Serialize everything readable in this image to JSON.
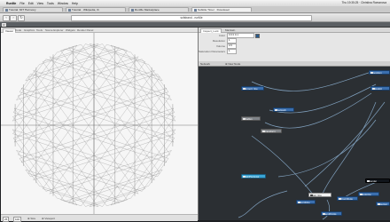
{
  "menubar": {
    "apple": "",
    "app_name": "RunMe",
    "items": [
      "File",
      "Edit",
      "View",
      "Tools",
      "Window",
      "Help"
    ],
    "status": "Thu 19:35:25 · Christina Romanova"
  },
  "browser": {
    "tabs": [
      {
        "label": "Tutorial: MIT Harmony"
      },
      {
        "label": "Tutorial · Wikipedia, th"
      },
      {
        "label": "RunMe Marketplace"
      },
      {
        "label": "Subtitle Timer · Download"
      }
    ],
    "back_label": "‹",
    "forward_label": "›",
    "reload_label": "↻",
    "url": "sofstrand - runMe"
  },
  "app": {
    "logo": "R"
  },
  "viewport_tabs": [
    "Viewer",
    "Code",
    "Graphics",
    "Tools",
    "Scene Explorer",
    "Widgets",
    "Render Panel"
  ],
  "zoom": {
    "left_value": "25",
    "mid_value": "100",
    "label_a": "⊕ Size",
    "label_b": "⊕ Viewport"
  },
  "inspector": {
    "tabs": [
      "Inspect_Lock",
      "Maintain"
    ],
    "rows": [
      {
        "label": "Color",
        "value": "0 0 0 0.1"
      },
      {
        "label": "Resolution",
        "value": "1"
      },
      {
        "label": "Volume",
        "value": "0.5"
      },
      {
        "label": "Saturation Parameters",
        "value": "1"
      }
    ],
    "swatch_color": "#2a5b8c"
  },
  "graph": {
    "header_left": "Network",
    "header_right": "⊕ New Node",
    "nodes": [
      {
        "label": "import_line",
        "style": "blue"
      },
      {
        "label": "network",
        "style": "blue"
      },
      {
        "label": "position",
        "style": "blue"
      },
      {
        "label": "radius",
        "style": "gray"
      },
      {
        "label": "transform",
        "style": "gray"
      },
      {
        "label": "lookAt",
        "style": "blue"
      },
      {
        "label": "tabPreviews",
        "style": "cyan"
      },
      {
        "label": "out_line",
        "style": "white"
      },
      {
        "label": "combine",
        "style": "blue"
      },
      {
        "label": "Contribute",
        "style": "blue"
      },
      {
        "label": "endPoints",
        "style": "blue"
      },
      {
        "label": "colorize",
        "style": "blue"
      },
      {
        "label": "render",
        "style": "dark"
      },
      {
        "label": "output",
        "style": "blue"
      }
    ]
  }
}
